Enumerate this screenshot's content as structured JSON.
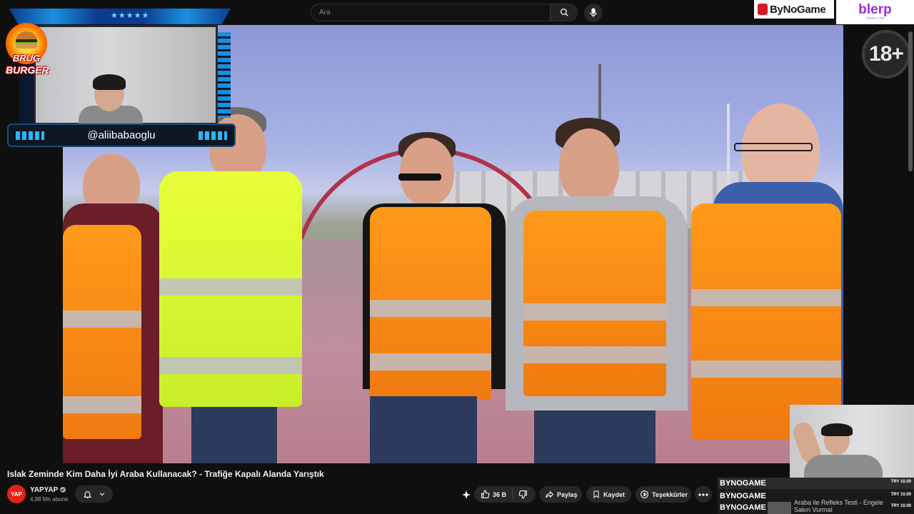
{
  "search": {
    "placeholder": "Ara"
  },
  "sponsors": {
    "bynogame": "ByNoGame",
    "blerp": "blerp",
    "blerp_sub": "Viewer Link"
  },
  "overlay": {
    "streamer_handle": "@aliibabaoglu",
    "badge_line1": "BRUG",
    "badge_line2": "BURGER",
    "age_badge": "18+"
  },
  "video": {
    "title": "Islak Zeminde Kim Daha İyi Araba Kullanacak? - Trafiğe Kapalı Alanda Yarıştık",
    "channel": "YAPYAP",
    "channel_logo": "YAP",
    "subscribers": "4,98 Mn abone"
  },
  "actions": {
    "likes": "36 B",
    "share": "Paylaş",
    "save": "Kaydet",
    "thanks": "Teşekkürler"
  },
  "bynogame_list": {
    "rows": [
      {
        "name": "BYNOGAME",
        "price": "TRY 10.00"
      },
      {
        "name": "BYNOGAME",
        "price": "TRY 10.00"
      },
      {
        "name": "BYNOGAME",
        "price": "TRY 10.00"
      }
    ],
    "next_video": "Araba ile Refleks Testi - Engele Sakın Vurmal"
  },
  "colors": {
    "accent": "#e62117",
    "overlay_blue": "#1a8fe0",
    "vest_orange": "#ff9a1a",
    "vest_yellow": "#e8ff3a"
  }
}
